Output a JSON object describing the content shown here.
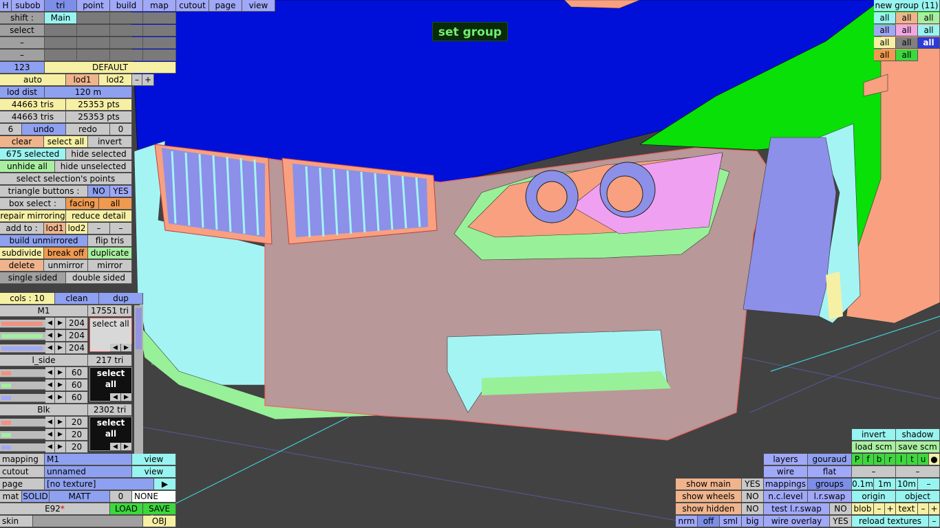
{
  "tooltip": "set group",
  "menu": {
    "h": "H",
    "subob": "subob",
    "tri": "tri",
    "point": "point",
    "build": "build",
    "map": "map",
    "cutout": "cutout",
    "page": "page",
    "view": "view"
  },
  "left": {
    "shift_label": "shift :",
    "shift_main": "Main",
    "select": "select",
    "dash": "–",
    "num": "123",
    "default": "DEFAULT",
    "auto": "auto",
    "lod1": "lod1",
    "lod2": "lod2",
    "minus": "–",
    "plus": "+",
    "lod_dist": "lod dist",
    "lod_dist_val": "120 m",
    "tris1": "44663 tris",
    "pts1": "25353 pts",
    "tris2": "44663 tris",
    "pts2": "25353 pts",
    "undo_count": "6",
    "undo": "undo",
    "redo": "redo",
    "redo_count": "0",
    "clear": "clear",
    "select_all": "select all",
    "invert": "invert",
    "selected": "675 selected",
    "hide_selected": "hide selected",
    "unhide_all": "unhide all",
    "hide_unselected": "hide unselected",
    "select_points": "select selection's points",
    "tri_buttons": "triangle buttons :",
    "no": "NO",
    "yes": "YES",
    "box_select": "box select :",
    "facing": "facing",
    "all": "all",
    "repair_mirroring": "repair mirroring",
    "reduce_detail": "reduce detail",
    "add_to": "add to :",
    "build_unmirrored": "build unmirrored",
    "flip_tris": "flip tris",
    "subdivide": "subdivide",
    "break_off": "break off",
    "duplicate": "duplicate",
    "delete": "delete",
    "unmirror": "unmirror",
    "mirror": "mirror",
    "single_sided": "single sided",
    "double_sided": "double sided",
    "cols": "cols : 10",
    "clean": "clean",
    "dup": "dup"
  },
  "materials": [
    {
      "name": "M1",
      "tris": "17551 tri",
      "vals": [
        "204",
        "204",
        "204"
      ],
      "sel": "select all",
      "dark": false
    },
    {
      "name": "l_side",
      "tris": "217 tri",
      "vals": [
        "60",
        "60",
        "60"
      ],
      "sel": "select all",
      "dark": true
    },
    {
      "name": "Blk",
      "tris": "2302 tri",
      "vals": [
        "20",
        "20",
        "20"
      ],
      "sel": "select all",
      "dark": true
    }
  ],
  "bottom_left": {
    "mapping": "mapping",
    "mapping_val": "M1",
    "view": "view",
    "cutout": "cutout",
    "cutout_val": "unnamed",
    "page": "page",
    "page_val": "[no texture]",
    "page_arrow": "▶",
    "mat": "mat",
    "solid": "SOLID",
    "matt": "MATT",
    "zero": "0",
    "none": "NONE",
    "e92": "E92",
    "star": "*",
    "load": "LOAD",
    "save": "SAVE",
    "skin": "skin",
    "obj": "OBJ"
  },
  "top_right": {
    "title": "new group (11)",
    "grid": [
      [
        "all",
        "all",
        "all"
      ],
      [
        "all",
        "all",
        "all"
      ],
      [
        "all",
        "all",
        "all"
      ],
      [
        "all",
        "all"
      ]
    ]
  },
  "bottom_right": {
    "show_main": "show main",
    "show_wheels": "show wheels",
    "show_hidden": "show hidden",
    "yes": "YES",
    "no": "NO",
    "nrm": "nrm",
    "off": "off",
    "sml": "sml",
    "big": "big",
    "layers": "layers",
    "gouraud": "gouraud",
    "wire": "wire",
    "flat": "flat",
    "mappings": "mappings",
    "groups": "groups",
    "nc_level": "n.c.level",
    "lr_swap": "l.r.swap",
    "test_lr_swap": "test l.r.swap",
    "wire_overlay": "wire overlay",
    "invert": "invert",
    "shadow": "shadow",
    "load_scm": "load scm",
    "save_scm": "save scm",
    "letters": [
      "P",
      "f",
      "b",
      "r",
      "l",
      "t",
      "u",
      "●"
    ],
    "dash": "–",
    "d01": "0.1m",
    "d1": "1m",
    "d10": "10m",
    "origin": "origin",
    "object": "object",
    "blob": "blob",
    "text": "text",
    "minus": "–",
    "plus": "+",
    "reload_textures": "reload textures"
  },
  "colors": {
    "sky": "#0010d8",
    "bumper": "#b89898",
    "light_blue": "#a4f4f4",
    "green": "#08e008",
    "pink": "#f8a080"
  }
}
